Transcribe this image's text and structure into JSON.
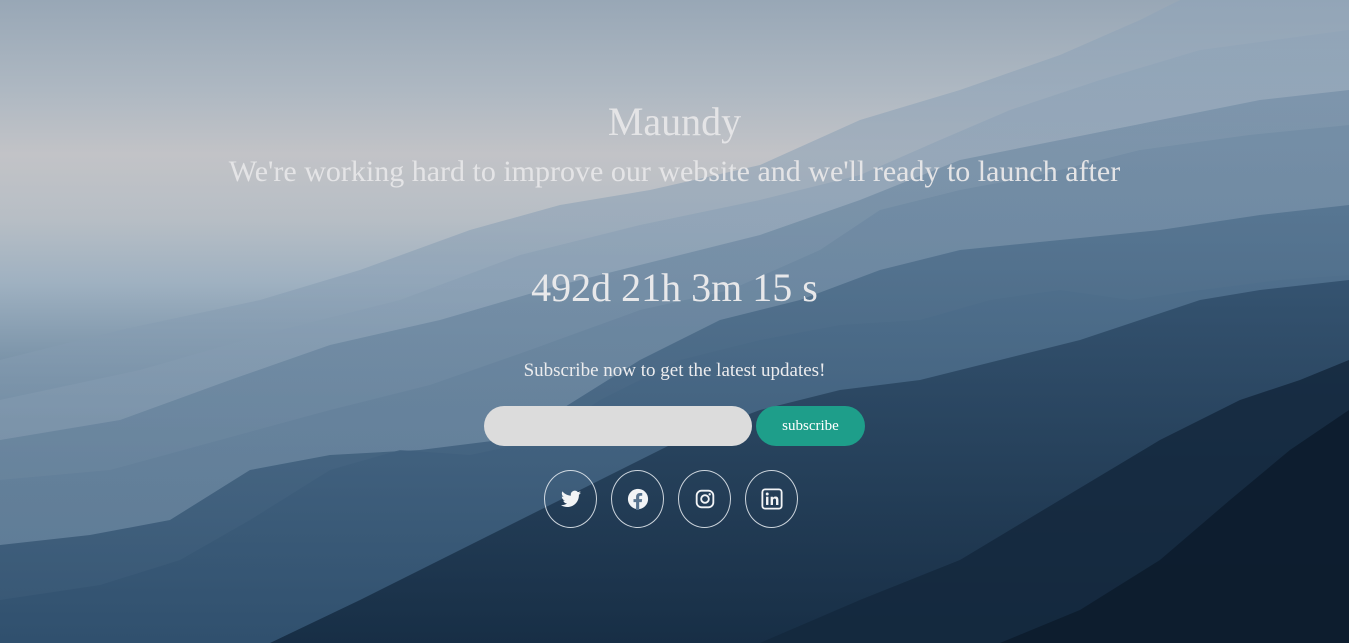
{
  "site": {
    "title": "Maundy",
    "tagline": "We're working hard to improve our website and we'll ready to launch after"
  },
  "countdown": {
    "days": "492d",
    "hours": "21h",
    "minutes": "3m",
    "seconds": "15 s"
  },
  "subscribe": {
    "prompt": "Subscribe now to get the latest updates!",
    "email_value": "",
    "email_placeholder": "",
    "button_label": "subscribe",
    "button_color": "#1e9e8a"
  },
  "social": [
    {
      "icon": "twitter-icon"
    },
    {
      "icon": "facebook-icon"
    },
    {
      "icon": "instagram-icon"
    },
    {
      "icon": "linkedin-icon"
    }
  ]
}
